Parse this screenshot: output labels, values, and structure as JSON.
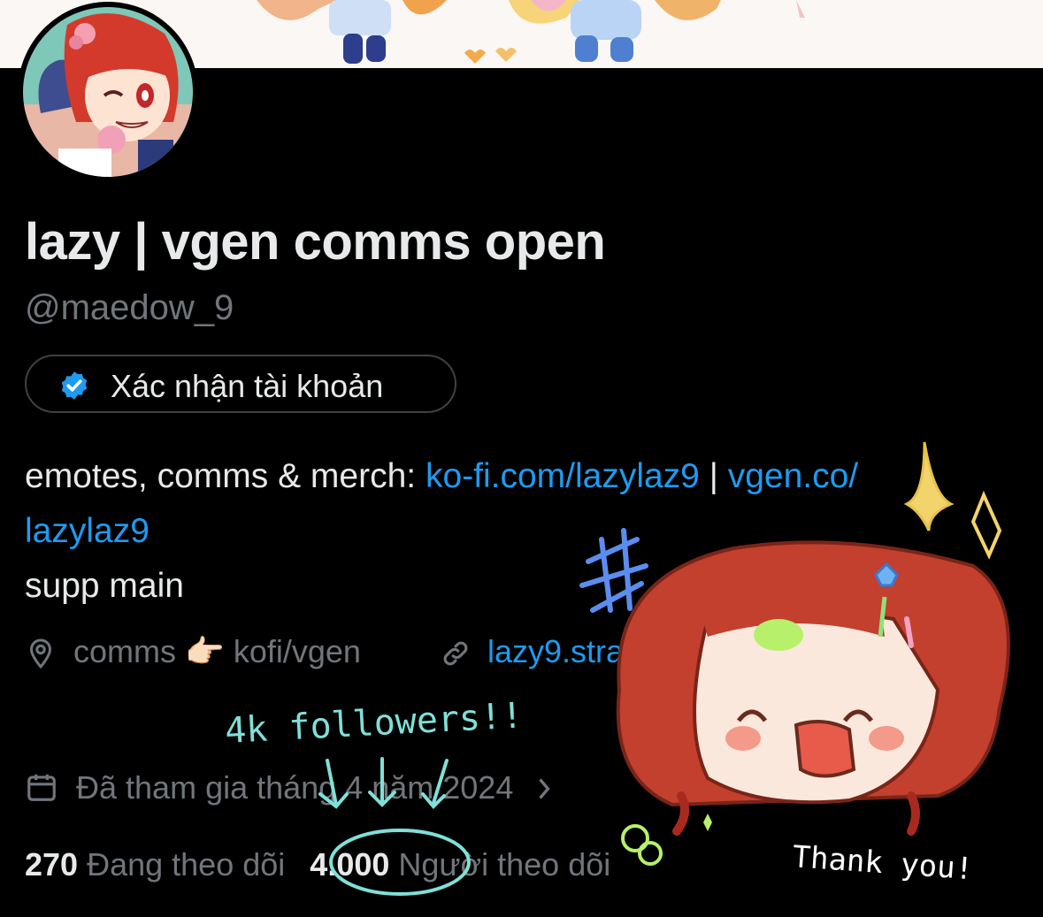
{
  "profile": {
    "display_name": "lazy | vgen comms open",
    "handle": "@maedow_9",
    "verify_label": "Xác nhận tài khoản",
    "bio": {
      "prefix": "emotes, comms & merch: ",
      "link1": "ko-fi.com/lazylaz9",
      "separator": " | ",
      "link2": "vgen.co/",
      "link2_cont": "lazylaz9",
      "line3": "supp main"
    },
    "location": "comms 👉🏻 kofi/vgen",
    "website": "lazy9.stra",
    "joined": "Đã tham gia tháng 4 năm 2024",
    "following_count": "270",
    "following_label": "Đang theo dõi",
    "followers_count": "4.000",
    "followers_label": "Người theo dõi"
  },
  "annotations": {
    "headline": "4k followers!!",
    "thanks": "Thank you!"
  },
  "colors": {
    "link": "#1d9bf0",
    "muted": "#71767b",
    "doodle": "#7fe0d8"
  }
}
